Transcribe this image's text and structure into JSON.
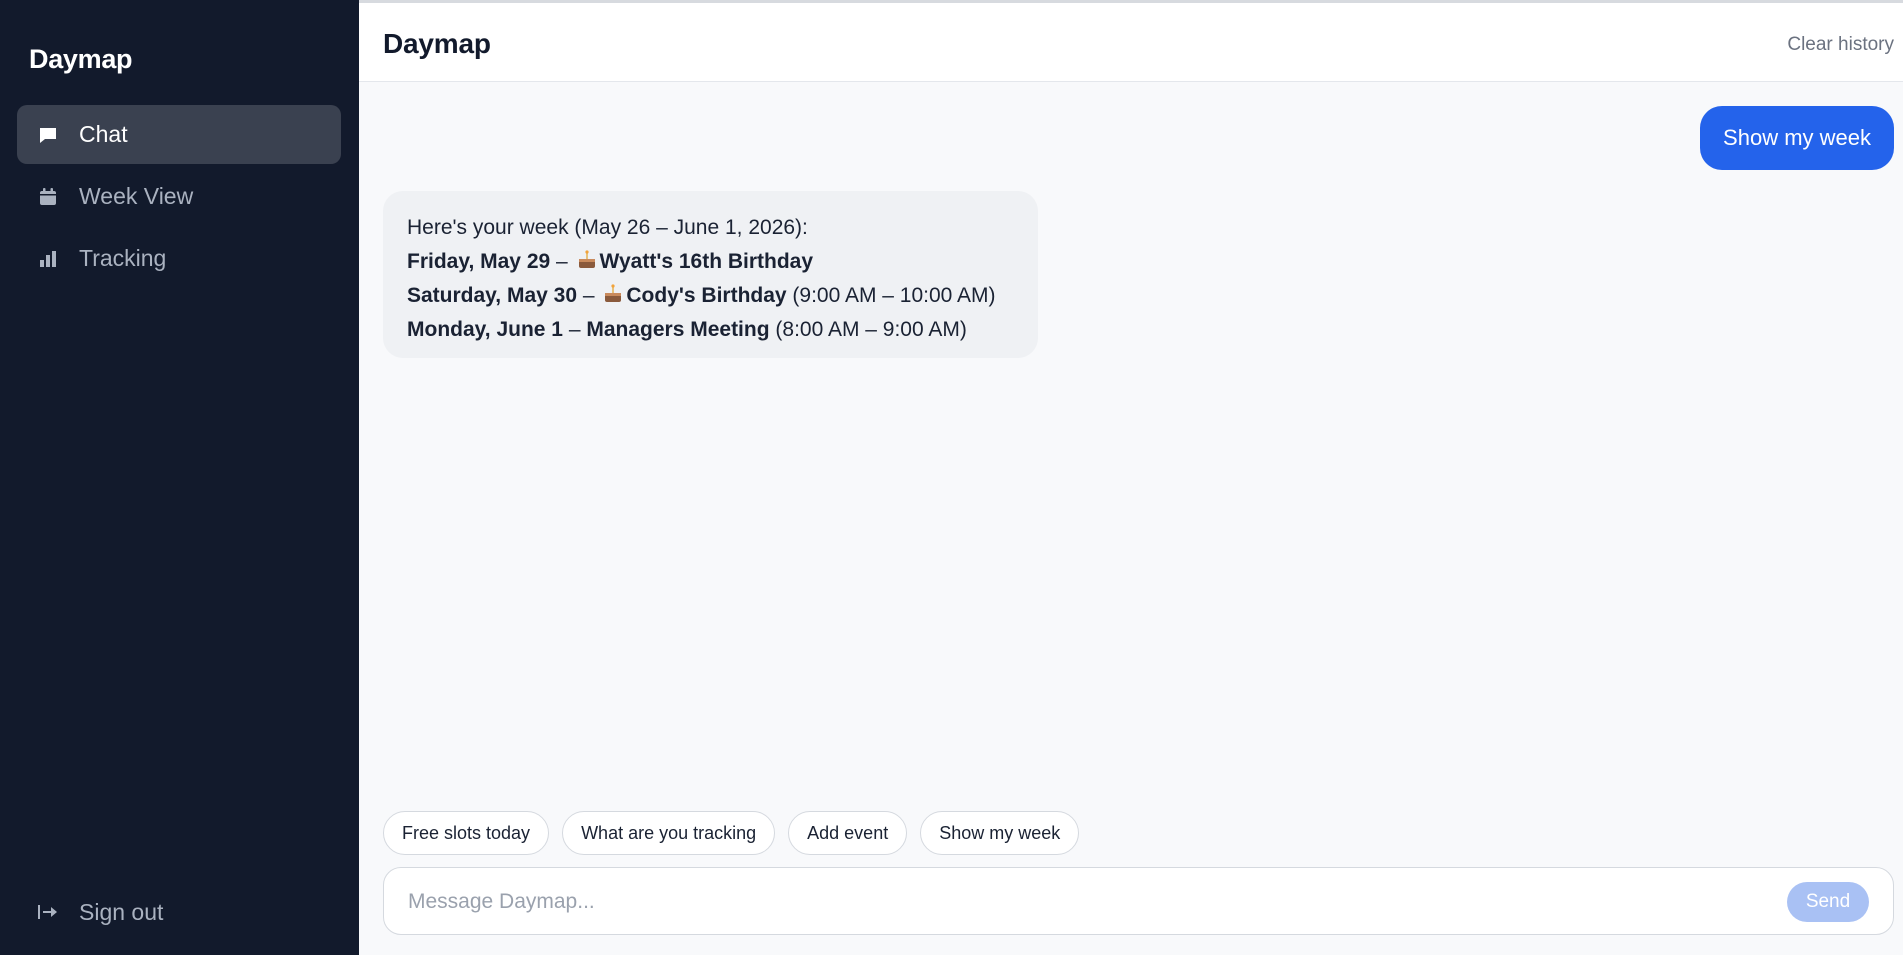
{
  "sidebar": {
    "brand": "Daymap",
    "items": [
      {
        "label": "Chat",
        "icon": "chat-bubble-icon",
        "active": true
      },
      {
        "label": "Week View",
        "icon": "calendar-icon",
        "active": false
      },
      {
        "label": "Tracking",
        "icon": "bar-chart-icon",
        "active": false
      }
    ],
    "signout": {
      "label": "Sign out",
      "icon": "sign-out-icon"
    }
  },
  "header": {
    "title": "Daymap",
    "clear_label": "Clear history"
  },
  "messages": {
    "user": "Show my week",
    "bot": {
      "intro": "Here's your week (May 26 – June 1, 2026):",
      "lines": [
        {
          "bold_prefix": "Friday, May 29",
          "sep": " – ",
          "emoji": "cake-icon",
          "bold_title": "Wyatt's 16th Birthday",
          "time": ""
        },
        {
          "bold_prefix": "Saturday, May 30",
          "sep": " – ",
          "emoji": "cake-icon",
          "bold_title": "Cody's Birthday",
          "time": " (9:00 AM – 10:00 AM)"
        },
        {
          "bold_prefix": "Monday, June 1",
          "sep": " – ",
          "emoji": "",
          "bold_title": "Managers Meeting",
          "time": " (8:00 AM – 9:00 AM)"
        }
      ]
    }
  },
  "suggestions": [
    "Free slots today",
    "What are you tracking",
    "Add event",
    "Show my week"
  ],
  "composer": {
    "placeholder": "Message Daymap...",
    "value": "",
    "send_label": "Send"
  },
  "colors": {
    "sidebar_bg": "#121a2c",
    "accent": "#2463eb",
    "send_disabled": "#a9c1f4"
  }
}
